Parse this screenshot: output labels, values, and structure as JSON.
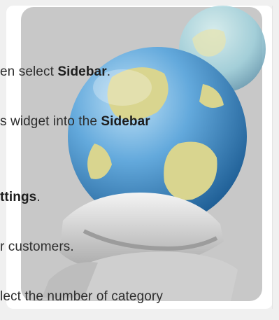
{
  "lines": [
    {
      "a": "en select ",
      "b": "Sidebar",
      "c": "."
    },
    {
      "a": "s widget into the ",
      "b": "Sidebar",
      "c": ""
    },
    {
      "a": "",
      "b": "ttings",
      "c": "."
    },
    {
      "a": "r customers.",
      "b": "",
      "c": ""
    },
    {
      "a": "lect the number of category",
      "b": "",
      "c": ""
    }
  ],
  "colors": {
    "text": "#2d2d2d",
    "globe_blue": "#4f95cf",
    "land_yellow": "#d3d08a",
    "stand": "#c9c9c9",
    "background": "#ffffff"
  },
  "icon": "globe-on-stand-icon"
}
